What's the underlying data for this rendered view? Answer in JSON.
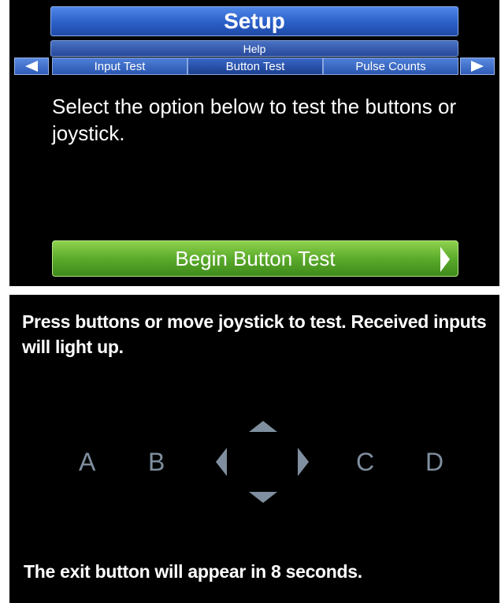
{
  "setup_screen": {
    "title": "Setup",
    "help_label": "Help",
    "tabs": [
      {
        "label": "Input Test"
      },
      {
        "label": "Button Test",
        "active": true
      },
      {
        "label": "Pulse Counts"
      }
    ],
    "nav_left_icon": "arrow-left-icon",
    "nav_right_icon": "arrow-right-icon",
    "prompt": "Select the option below to test the buttons or joystick.",
    "begin_button_label": "Begin Button Test",
    "colors": {
      "title_blue": "#2b5fc8",
      "button_green": "#5bab2b",
      "background": "#000000"
    }
  },
  "test_screen": {
    "instructions": "Press buttons or move joystick to test. Received inputs will light up.",
    "buttons": [
      "A",
      "B",
      "C",
      "D"
    ],
    "joystick_icons": [
      "joystick-up-icon",
      "joystick-down-icon",
      "joystick-left-icon",
      "joystick-right-icon"
    ],
    "exit_note": "The exit button will appear in 8 seconds.",
    "colors": {
      "inactive_input": "#7f8f9f"
    }
  }
}
